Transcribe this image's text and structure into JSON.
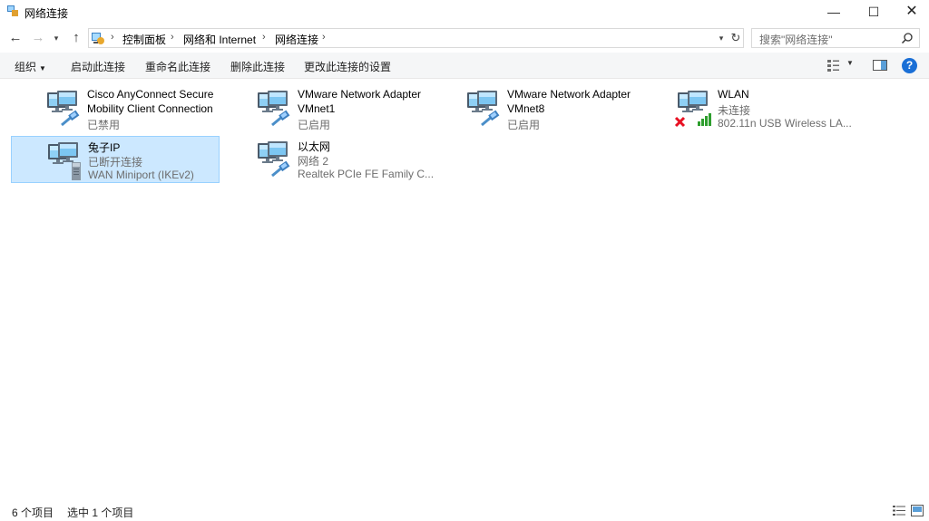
{
  "window": {
    "title": "网络连接",
    "minimize": "—",
    "maximize": "☐",
    "close": "✕"
  },
  "nav": {
    "back": "←",
    "forward": "→",
    "history": "▾",
    "up": "↑"
  },
  "address": {
    "breadcrumbs": [
      "控制面板",
      "网络和 Internet",
      "网络连接"
    ],
    "separator": "›",
    "dropdown": "▾",
    "refresh": "↻"
  },
  "search": {
    "placeholder": "搜索\"网络连接\""
  },
  "commandbar": {
    "organize": "组织",
    "organize_arrow": "▼",
    "commands": [
      "启动此连接",
      "重命名此连接",
      "删除此连接",
      "更改此连接的设置"
    ],
    "view_dropdown": "▼",
    "help": "?"
  },
  "connections": [
    {
      "name": "Cisco AnyConnect Secure",
      "name2": "Mobility Client Connection",
      "status": "已禁用",
      "icon": "network-adapter-icon"
    },
    {
      "name": "VMware Network Adapter",
      "name2": "VMnet1",
      "status": "已启用",
      "icon": "network-adapter-icon"
    },
    {
      "name": "VMware Network Adapter",
      "name2": "VMnet8",
      "status": "已启用",
      "icon": "network-adapter-icon"
    },
    {
      "name": "WLAN",
      "status": "未连接",
      "device": "802.11n USB Wireless LA...",
      "icon": "wireless-adapter-icon",
      "error_badge": "red-x"
    },
    {
      "name": "兔子IP",
      "status": "已断开连接",
      "device": "WAN Miniport (IKEv2)",
      "icon": "vpn-connection-icon",
      "selected": true
    },
    {
      "name": "以太网",
      "status": "网络 2",
      "device": "Realtek PCIe FE Family C...",
      "icon": "network-adapter-icon"
    }
  ],
  "statusbar": {
    "count": "6 个项目",
    "selected": "选中 1 个项目"
  },
  "colors": {
    "selection_bg": "#cce8ff",
    "selection_border": "#99d1ff",
    "help_blue": "#1a6fd6",
    "error_red": "#e81123",
    "signal_green": "#2e9e2e"
  }
}
